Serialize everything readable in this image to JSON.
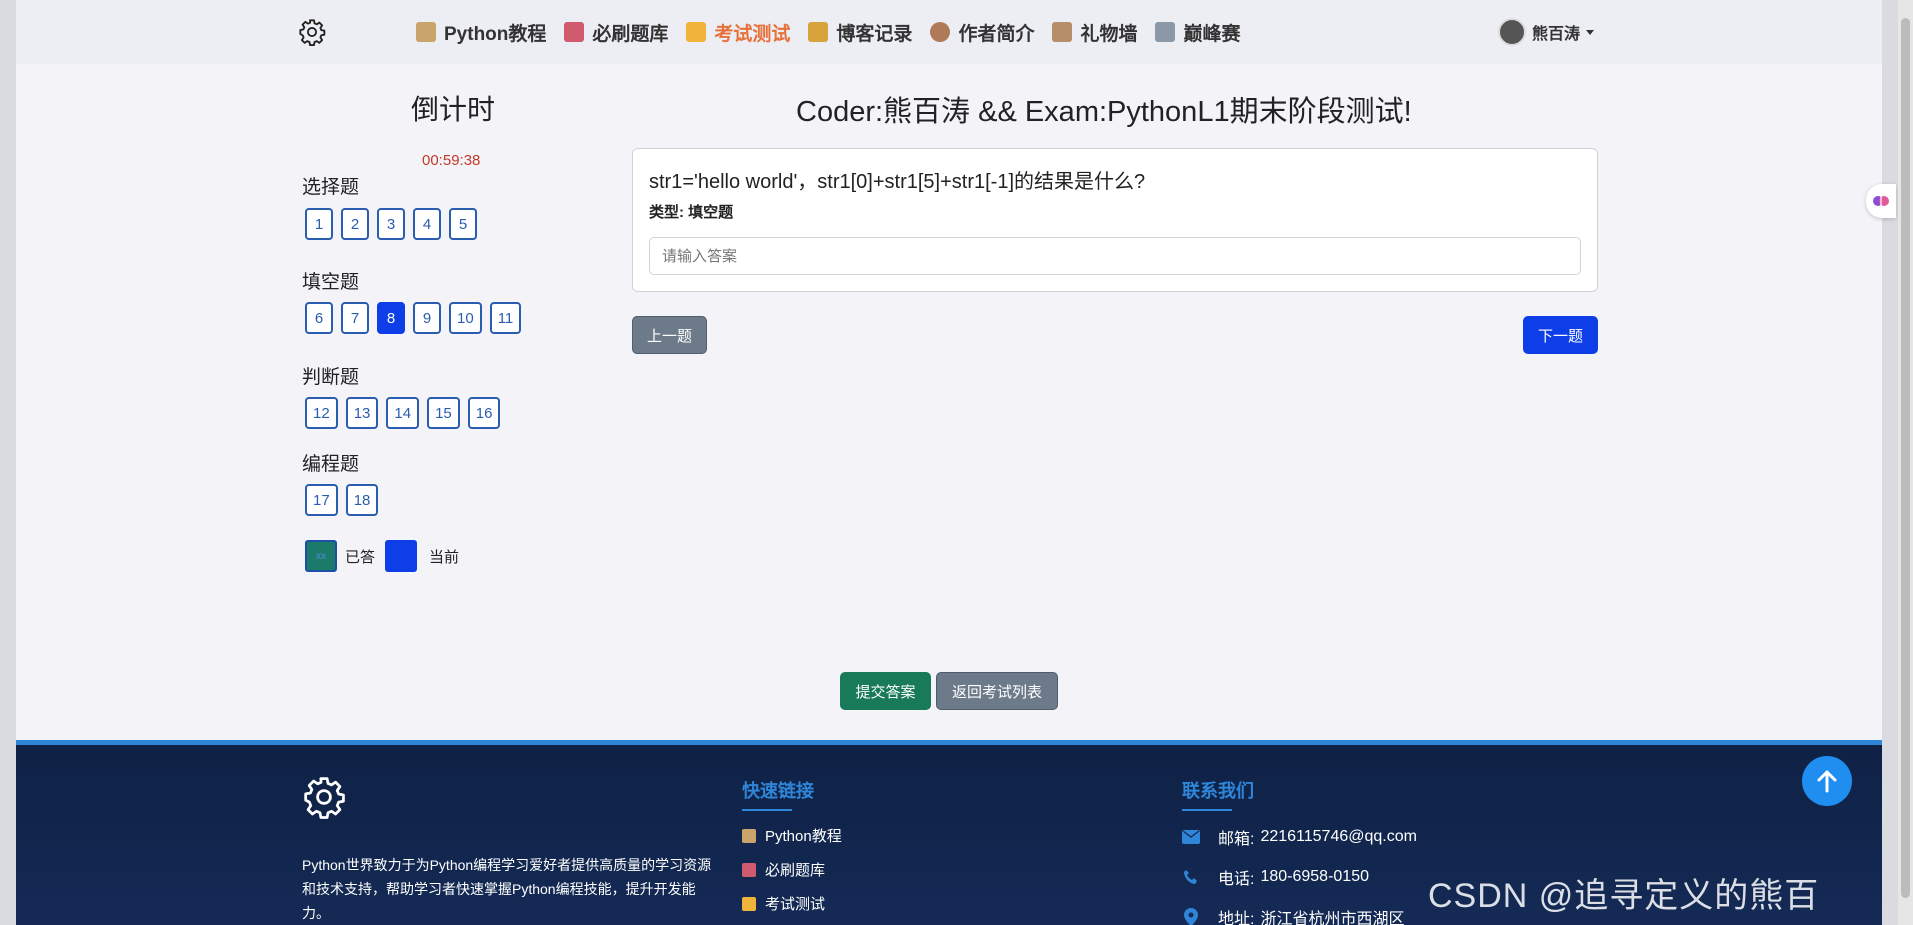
{
  "nav": {
    "items": [
      {
        "label": "Python教程",
        "icon": "scroll-icon",
        "color": "#c9a46b"
      },
      {
        "label": "必刷题库",
        "icon": "abacus-icon",
        "color": "#d05a6e"
      },
      {
        "label": "考试测试",
        "icon": "sparkles-icon",
        "color": "#f0b43a",
        "active": true
      },
      {
        "label": "博客记录",
        "icon": "card-box-icon",
        "color": "#d9a33c"
      },
      {
        "label": "作者简介",
        "icon": "bear-icon",
        "color": "#b07a5a"
      },
      {
        "label": "礼物墙",
        "icon": "package-icon",
        "color": "#b58e6a"
      },
      {
        "label": "巅峰赛",
        "icon": "crossed-swords-icon",
        "color": "#8a98a8"
      }
    ],
    "user": "熊百涛"
  },
  "sidebar": {
    "countdown_title": "倒计时",
    "countdown_time": "00:59:38",
    "sections": [
      {
        "title": "选择题",
        "questions": [
          "1",
          "2",
          "3",
          "4",
          "5"
        ]
      },
      {
        "title": "填空题",
        "questions": [
          "6",
          "7",
          "8",
          "9",
          "10",
          "11"
        ],
        "current": "8"
      },
      {
        "title": "判断题",
        "questions": [
          "12",
          "13",
          "14",
          "15",
          "16"
        ]
      },
      {
        "title": "编程题",
        "questions": [
          "17",
          "18"
        ]
      }
    ],
    "legend": {
      "done_sample": "xx",
      "done_label": "已答",
      "current_label": "当前"
    }
  },
  "main": {
    "title": "Coder:熊百涛 && Exam:PythonL1期末阶段测试!",
    "question": "str1='hello world'，str1[0]+str1[5]+str1[-1]的结果是什么?",
    "type_label": "类型: 填空题",
    "answer_placeholder": "请输入答案",
    "prev_label": "上一题",
    "next_label": "下一题",
    "submit_label": "提交答案",
    "back_label": "返回考试列表"
  },
  "footer": {
    "description": "Python世界致力于为Python编程学习爱好者提供高质量的学习资源和技术支持，帮助学习者快速掌握Python编程技能，提升开发能力。",
    "links_title": "快速链接",
    "links": [
      {
        "label": "Python教程",
        "color": "#c9a46b"
      },
      {
        "label": "必刷题库",
        "color": "#d05a6e"
      },
      {
        "label": "考试测试",
        "color": "#f0b43a"
      }
    ],
    "contact_title": "联系我们",
    "contacts": [
      {
        "label": "邮箱:",
        "value": "2216115746@qq.com",
        "icon": "envelope-icon"
      },
      {
        "label": "电话:",
        "value": "180-6958-0150",
        "icon": "phone-icon"
      },
      {
        "label": "地址:",
        "value": "浙江省杭州市西湖区",
        "icon": "location-pin-icon"
      }
    ]
  },
  "watermark": "CSDN @追寻定义的熊百涛！",
  "colors": {
    "accent": "#0d3ee8",
    "active_nav": "#e8703a",
    "timer": "#c0392b",
    "footer_accent": "#2f86d8"
  }
}
